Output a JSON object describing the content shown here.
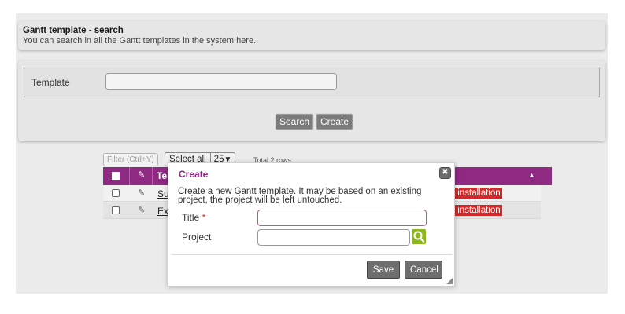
{
  "header": {
    "title": "Gantt template - search",
    "subtitle": "You can search in all the Gantt templates in the system here."
  },
  "search": {
    "template_label": "Template",
    "template_value": "",
    "search_button": "Search",
    "create_button": "Create"
  },
  "toolbar": {
    "filter_placeholder": "Filter (Ctrl+Y)",
    "select_all": "Select all",
    "page_size": "25",
    "total_rows": "Total 2 rows"
  },
  "table": {
    "header_partial": "Te",
    "rows": [
      {
        "name_partial": "Su",
        "badge": "ll installation"
      },
      {
        "name_partial": "Ex",
        "badge": "ll installation"
      }
    ]
  },
  "dialog": {
    "title": "Create",
    "close_glyph": "✖",
    "description": "Create a new Gantt template. It may be based on an existing project, the project will be left untouched.",
    "title_label": "Title",
    "required_mark": "*",
    "title_value": "",
    "project_label": "Project",
    "project_value": "",
    "save_button": "Save",
    "cancel_button": "Cancel"
  },
  "colors": {
    "accent": "#8e2a82",
    "badge": "#d02a2a",
    "lookup": "#8cb81e"
  },
  "icons": {
    "edit": "pencil-icon",
    "lookup": "search-icon",
    "close": "close-icon",
    "sort": "sort-asc-icon",
    "dropdown": "chevron-down-icon"
  }
}
